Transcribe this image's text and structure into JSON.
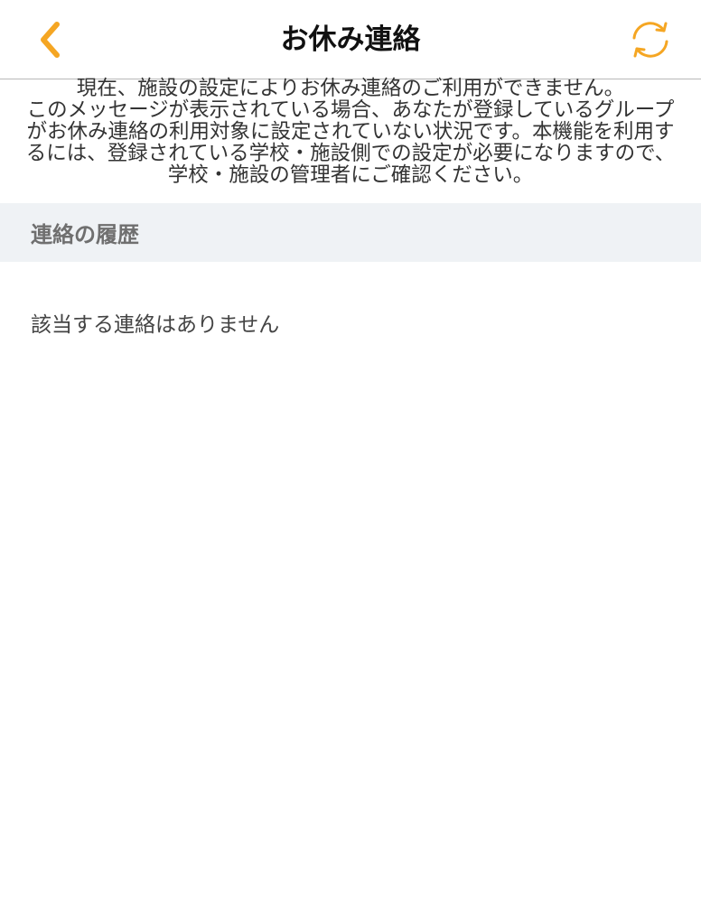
{
  "header": {
    "title": "お休み連絡",
    "back_icon": "chevron-left-icon",
    "refresh_icon": "refresh-icon",
    "accent_color": "#f5a623"
  },
  "notice": {
    "lines": [
      "現在、施設の設定によりお休み連絡のご利用ができません。",
      "このメッセージが表示されている場合、あなたが登録しているグループ",
      "がお休み連絡の利用対象に設定されていない状況です。本機能を利用す",
      "るには、登録されている学校・施設側での設定が必要になりますので、",
      "学校・施設の管理者にご確認ください。"
    ]
  },
  "history": {
    "section_title": "連絡の履歴",
    "empty_message": "該当する連絡はありません"
  }
}
